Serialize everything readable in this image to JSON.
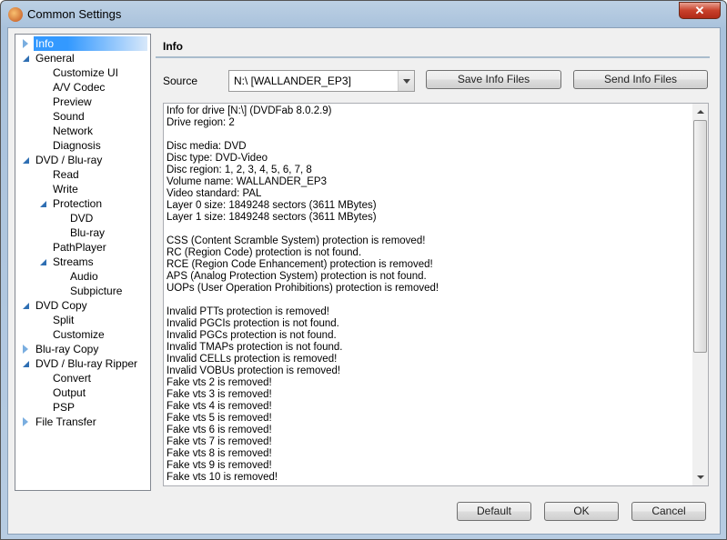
{
  "window": {
    "title": "Common Settings",
    "close": "✕"
  },
  "tree": [
    {
      "label": "Info",
      "level": 0,
      "arrow": "collapsed",
      "selected": true
    },
    {
      "label": "General",
      "level": 0,
      "arrow": "expanded"
    },
    {
      "label": "Customize UI",
      "level": 1
    },
    {
      "label": "A/V Codec",
      "level": 1
    },
    {
      "label": "Preview",
      "level": 1
    },
    {
      "label": "Sound",
      "level": 1
    },
    {
      "label": "Network",
      "level": 1
    },
    {
      "label": "Diagnosis",
      "level": 1
    },
    {
      "label": "DVD / Blu-ray",
      "level": 0,
      "arrow": "expanded"
    },
    {
      "label": "Read",
      "level": 1
    },
    {
      "label": "Write",
      "level": 1
    },
    {
      "label": "Protection",
      "level": 1,
      "arrow": "expanded"
    },
    {
      "label": "DVD",
      "level": 2
    },
    {
      "label": "Blu-ray",
      "level": 2
    },
    {
      "label": "PathPlayer",
      "level": 1
    },
    {
      "label": "Streams",
      "level": 1,
      "arrow": "expanded"
    },
    {
      "label": "Audio",
      "level": 2
    },
    {
      "label": "Subpicture",
      "level": 2
    },
    {
      "label": "DVD Copy",
      "level": 0,
      "arrow": "expanded"
    },
    {
      "label": "Split",
      "level": 1
    },
    {
      "label": "Customize",
      "level": 1
    },
    {
      "label": "Blu-ray Copy",
      "level": 0,
      "arrow": "collapsed"
    },
    {
      "label": "DVD / Blu-ray Ripper",
      "level": 0,
      "arrow": "expanded"
    },
    {
      "label": "Convert",
      "level": 1
    },
    {
      "label": "Output",
      "level": 1
    },
    {
      "label": "PSP",
      "level": 1
    },
    {
      "label": "File Transfer",
      "level": 0,
      "arrow": "collapsed"
    }
  ],
  "panel": {
    "header": "Info",
    "source_label": "Source",
    "source_value": "N:\\ [WALLANDER_EP3]",
    "save_button": "Save Info Files",
    "send_button": "Send Info Files"
  },
  "info_lines": [
    "Info for drive [N:\\] (DVDFab 8.0.2.9)",
    "Drive region: 2",
    "",
    "Disc media: DVD",
    "Disc type: DVD-Video",
    "Disc region: 1, 2, 3, 4, 5, 6, 7, 8",
    "Volume name: WALLANDER_EP3",
    "Video standard: PAL",
    "Layer 0 size: 1849248 sectors (3611 MBytes)",
    "Layer 1 size: 1849248 sectors (3611 MBytes)",
    "",
    "CSS (Content Scramble System) protection is removed!",
    "RC (Region Code) protection is not found.",
    "RCE (Region Code Enhancement) protection is removed!",
    "APS (Analog Protection System) protection is not found.",
    "UOPs (User Operation Prohibitions) protection is removed!",
    "",
    "Invalid PTTs protection is removed!",
    "Invalid PGCIs protection is not found.",
    "Invalid PGCs protection is not found.",
    "Invalid TMAPs protection is not found.",
    "Invalid CELLs protection is removed!",
    "Invalid VOBUs protection is removed!",
    "Fake vts 2 is removed!",
    "Fake vts 3 is removed!",
    "Fake vts 4 is removed!",
    "Fake vts 5 is removed!",
    "Fake vts 6 is removed!",
    "Fake vts 7 is removed!",
    "Fake vts 8 is removed!",
    "Fake vts 9 is removed!",
    "Fake vts 10 is removed!"
  ],
  "footer": {
    "default": "Default",
    "ok": "OK",
    "cancel": "Cancel"
  }
}
